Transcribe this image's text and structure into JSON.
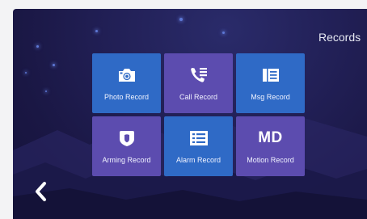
{
  "screen_title": "Records",
  "colors": {
    "tile_blue": "#2f6ac6",
    "tile_purple": "#5c4caf",
    "background": "#1e1b4f"
  },
  "tiles": [
    {
      "label": "Photo Record",
      "icon": "camera-icon",
      "color": "blue"
    },
    {
      "label": "Call Record",
      "icon": "phone-list-icon",
      "color": "purple"
    },
    {
      "label": "Msg Record",
      "icon": "message-list-icon",
      "color": "blue"
    },
    {
      "label": "Arming Record",
      "icon": "shield-icon",
      "color": "purple"
    },
    {
      "label": "Alarm Record",
      "icon": "list-icon",
      "color": "blue"
    },
    {
      "label": "Motion Record",
      "icon": "md-text-icon",
      "icon_text": "MD",
      "color": "purple"
    }
  ],
  "back_button": {
    "icon": "chevron-left-icon"
  }
}
